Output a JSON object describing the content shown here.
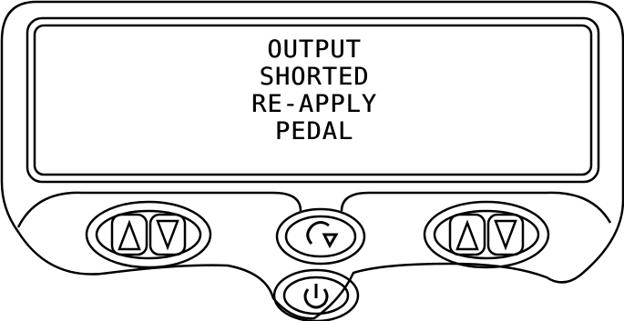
{
  "display": {
    "lines": [
      "OUTPUT",
      "SHORTED",
      "RE-APPLY",
      "PEDAL"
    ]
  },
  "controls": {
    "left_pair": [
      "up-arrow-icon",
      "down-arrow-icon"
    ],
    "right_pair": [
      "up-arrow-icon",
      "down-arrow-icon"
    ],
    "center": "refresh-icon",
    "bottom": "power-icon"
  }
}
